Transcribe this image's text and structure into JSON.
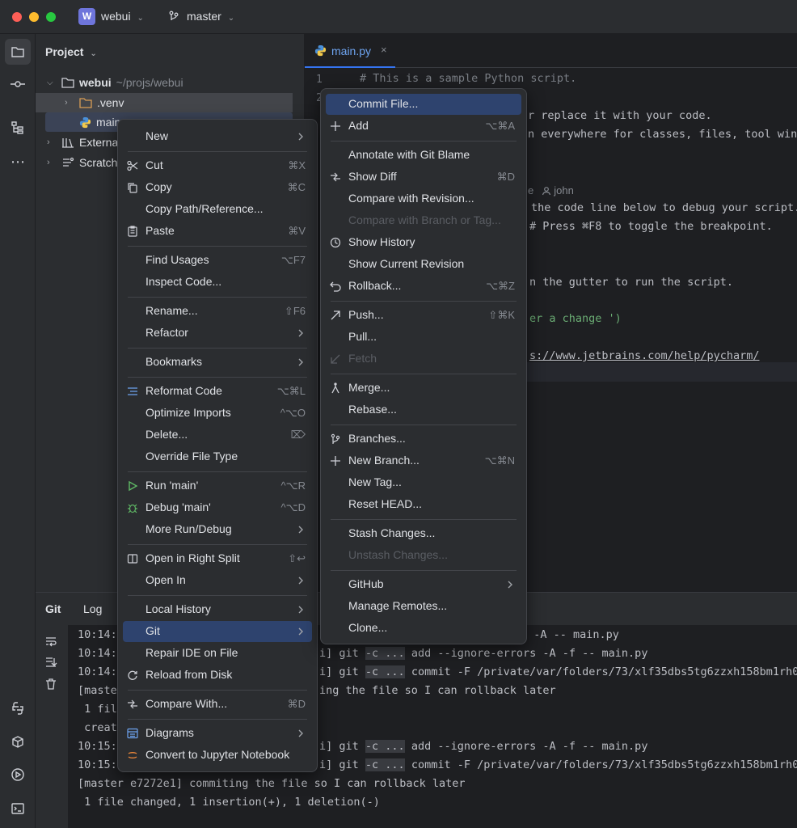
{
  "titlebar": {
    "project_badge": "W",
    "project_name": "webui",
    "branch": "master"
  },
  "project_panel": {
    "title": "Project",
    "tree": [
      {
        "label": "webui",
        "path": "~/projs/webui"
      },
      {
        "label": ".venv"
      },
      {
        "label": "main"
      },
      {
        "label": "External"
      },
      {
        "label": "Scratch"
      }
    ]
  },
  "editor": {
    "tab_label": "main.py",
    "line_numbers": [
      "1",
      "2"
    ],
    "lines": [
      "# This is a sample Python script.",
      "r replace it with your code.",
      "n everywhere for classes, files, tool wind",
      "the code line below to debug your script.",
      "# Press ⌘F8 to toggle the breakpoint.",
      "n the gutter to run the script.",
      "er a change ')",
      "s://www.jetbrains.com/help/pycharm/"
    ],
    "blame_suffix": "e",
    "blame_author": "john"
  },
  "bottom_panel": {
    "tabs": [
      "Git",
      "Log"
    ],
    "log": [
      {
        "time": "10:14:",
        "rest": "s -A -- main.py"
      },
      {
        "time": "10:14:",
        "pre": "i] git",
        "opt": "-c ...",
        "cmd": "add --ignore-errors -A -f -- main.py"
      },
      {
        "time": "10:14:",
        "pre": "i] git",
        "opt": "-c ...",
        "cmd": "commit -F /private/var/folders/73/xlf35dbs5tg6zzxh158bm1rh0"
      },
      {
        "time": "[master",
        "rest": "ing the file so I can rollback later"
      },
      {
        "time": " 1 fil",
        "rest": ""
      },
      {
        "time": " creat",
        "rest": ""
      },
      {
        "time": "10:15:",
        "pre": "i] git",
        "opt": "-c ...",
        "cmd": "add --ignore-errors -A -f -- main.py"
      },
      {
        "time": "10:15:",
        "pre": "i] git",
        "opt": "-c ...",
        "cmd": "commit -F /private/var/folders/73/xlf35dbs5tg6zzxh158bm1rh0"
      },
      {
        "full": "[master e7272e1] commiting the file so I can rollback later"
      },
      {
        "full": " 1 file changed, 1 insertion(+), 1 deletion(-)"
      }
    ]
  },
  "context_menu": [
    {
      "label": "New",
      "submenu": true
    },
    {
      "sep": true
    },
    {
      "label": "Cut",
      "shortcut": "⌘X",
      "icon": "scissors-icon"
    },
    {
      "label": "Copy",
      "shortcut": "⌘C",
      "icon": "copy-icon"
    },
    {
      "label": "Copy Path/Reference..."
    },
    {
      "label": "Paste",
      "shortcut": "⌘V",
      "icon": "paste-icon"
    },
    {
      "sep": true
    },
    {
      "label": "Find Usages",
      "shortcut": "⌥F7"
    },
    {
      "label": "Inspect Code..."
    },
    {
      "sep": true
    },
    {
      "label": "Rename...",
      "shortcut": "⇧F6"
    },
    {
      "label": "Refactor",
      "submenu": true
    },
    {
      "sep": true
    },
    {
      "label": "Bookmarks",
      "submenu": true
    },
    {
      "sep": true
    },
    {
      "label": "Reformat Code",
      "shortcut": "⌥⌘L",
      "icon": "reformat-icon"
    },
    {
      "label": "Optimize Imports",
      "shortcut": "^⌥O"
    },
    {
      "label": "Delete...",
      "shortcut": "⌦"
    },
    {
      "label": "Override File Type"
    },
    {
      "sep": true
    },
    {
      "label": "Run 'main'",
      "shortcut": "^⌥R",
      "icon": "run-icon"
    },
    {
      "label": "Debug 'main'",
      "shortcut": "^⌥D",
      "icon": "debug-icon"
    },
    {
      "label": "More Run/Debug",
      "submenu": true
    },
    {
      "sep": true
    },
    {
      "label": "Open in Right Split",
      "shortcut": "⇧↩",
      "icon": "split-icon"
    },
    {
      "label": "Open In",
      "submenu": true
    },
    {
      "sep": true
    },
    {
      "label": "Local History",
      "submenu": true
    },
    {
      "label": "Git",
      "submenu": true,
      "selected": true
    },
    {
      "label": "Repair IDE on File"
    },
    {
      "label": "Reload from Disk",
      "icon": "reload-icon"
    },
    {
      "sep": true
    },
    {
      "label": "Compare With...",
      "shortcut": "⌘D",
      "icon": "compare-icon"
    },
    {
      "sep": true
    },
    {
      "label": "Diagrams",
      "submenu": true,
      "icon": "diagram-icon"
    },
    {
      "label": "Convert to Jupyter Notebook",
      "icon": "jupyter-icon"
    }
  ],
  "git_menu": [
    {
      "label": "Commit File...",
      "selected": true
    },
    {
      "label": "Add",
      "shortcut": "⌥⌘A",
      "icon": "plus-icon"
    },
    {
      "sep": true
    },
    {
      "label": "Annotate with Git Blame"
    },
    {
      "label": "Show Diff",
      "shortcut": "⌘D",
      "icon": "diff-icon"
    },
    {
      "label": "Compare with Revision..."
    },
    {
      "label": "Compare with Branch or Tag...",
      "disabled": true
    },
    {
      "label": "Show History",
      "icon": "history-icon"
    },
    {
      "label": "Show Current Revision"
    },
    {
      "label": "Rollback...",
      "shortcut": "⌥⌘Z",
      "icon": "rollback-icon"
    },
    {
      "sep": true
    },
    {
      "label": "Push...",
      "shortcut": "⇧⌘K",
      "icon": "push-icon"
    },
    {
      "label": "Pull..."
    },
    {
      "label": "Fetch",
      "disabled": true,
      "icon": "fetch-icon"
    },
    {
      "sep": true
    },
    {
      "label": "Merge...",
      "icon": "merge-icon"
    },
    {
      "label": "Rebase..."
    },
    {
      "sep": true
    },
    {
      "label": "Branches...",
      "icon": "branch-icon"
    },
    {
      "label": "New Branch...",
      "shortcut": "⌥⌘N",
      "icon": "plus-icon"
    },
    {
      "label": "New Tag..."
    },
    {
      "label": "Reset HEAD..."
    },
    {
      "sep": true
    },
    {
      "label": "Stash Changes..."
    },
    {
      "label": "Unstash Changes...",
      "disabled": true
    },
    {
      "sep": true
    },
    {
      "label": "GitHub",
      "submenu": true
    },
    {
      "label": "Manage Remotes..."
    },
    {
      "label": "Clone..."
    }
  ]
}
